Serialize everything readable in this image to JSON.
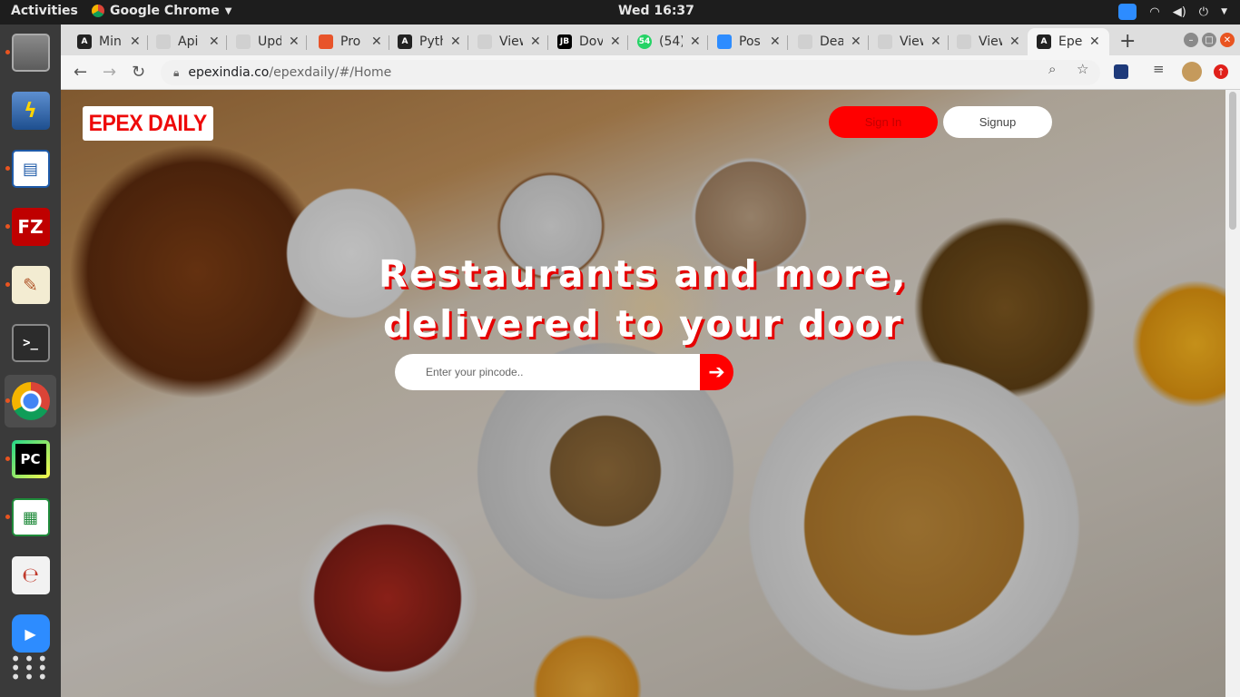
{
  "topbar": {
    "activities": "Activities",
    "app_name": "Google Chrome",
    "clock": "Wed 16:37"
  },
  "dock": {
    "items": [
      {
        "name": "files",
        "glyph": "",
        "color": "#6f6f6f"
      },
      {
        "name": "remote-desktop",
        "glyph": "",
        "color": "#2f6db3"
      },
      {
        "name": "libreoffice-draw",
        "glyph": "",
        "color": "#1e5aa8"
      },
      {
        "name": "filezilla",
        "glyph": "FZ",
        "color": "#bf0000"
      },
      {
        "name": "text-editor",
        "glyph": "",
        "color": "#e8e0c8"
      },
      {
        "name": "terminal",
        "glyph": ">_",
        "color": "#2c2c2c"
      },
      {
        "name": "chrome",
        "glyph": "",
        "color": "#3a3a3a"
      },
      {
        "name": "pycharm",
        "glyph": "PC",
        "color": "#1a1a1a"
      },
      {
        "name": "libreoffice-calc",
        "glyph": "",
        "color": "#1f8a3a"
      },
      {
        "name": "evince",
        "glyph": "",
        "color": "#e8e8e8"
      },
      {
        "name": "zoom",
        "glyph": "",
        "color": "#2d8cff"
      },
      {
        "name": "show-applications",
        "glyph": "",
        "color": "#3a3a3a"
      }
    ]
  },
  "tabs": [
    {
      "title": "Min",
      "fav_color": "#222",
      "fav": "A"
    },
    {
      "title": "Api",
      "fav_color": "#dedede",
      "fav": ""
    },
    {
      "title": "Upd",
      "fav_color": "#dedede",
      "fav": ""
    },
    {
      "title": "Pro",
      "fav_color": "#e8542a",
      "fav": ""
    },
    {
      "title": "Pyth",
      "fav_color": "#222",
      "fav": "A"
    },
    {
      "title": "View",
      "fav_color": "#dedede",
      "fav": ""
    },
    {
      "title": "Dov",
      "fav_color": "#000",
      "fav": "JB"
    },
    {
      "title": "(54)",
      "fav_color": "#25d366",
      "fav": "54"
    },
    {
      "title": "Pos",
      "fav_color": "#2d8cff",
      "fav": ""
    },
    {
      "title": "Dea",
      "fav_color": "#dedede",
      "fav": ""
    },
    {
      "title": "View",
      "fav_color": "#dedede",
      "fav": ""
    },
    {
      "title": "View",
      "fav_color": "#dedede",
      "fav": ""
    }
  ],
  "active_tab": {
    "title": "Epex",
    "fav": "A"
  },
  "address": {
    "host": "epexindia.co",
    "path": "/epexdaily/#/Home"
  },
  "site": {
    "logo": "EPEX DAILY",
    "signin_label": "Sign In",
    "signup_label": "Signup",
    "headline_line1": "Restaurants and more,",
    "headline_line2": "delivered to your door",
    "pincode_placeholder": "Enter your pincode.."
  },
  "colors": {
    "brand_red": "#ff0000",
    "logo_red": "#ee0a0a"
  }
}
